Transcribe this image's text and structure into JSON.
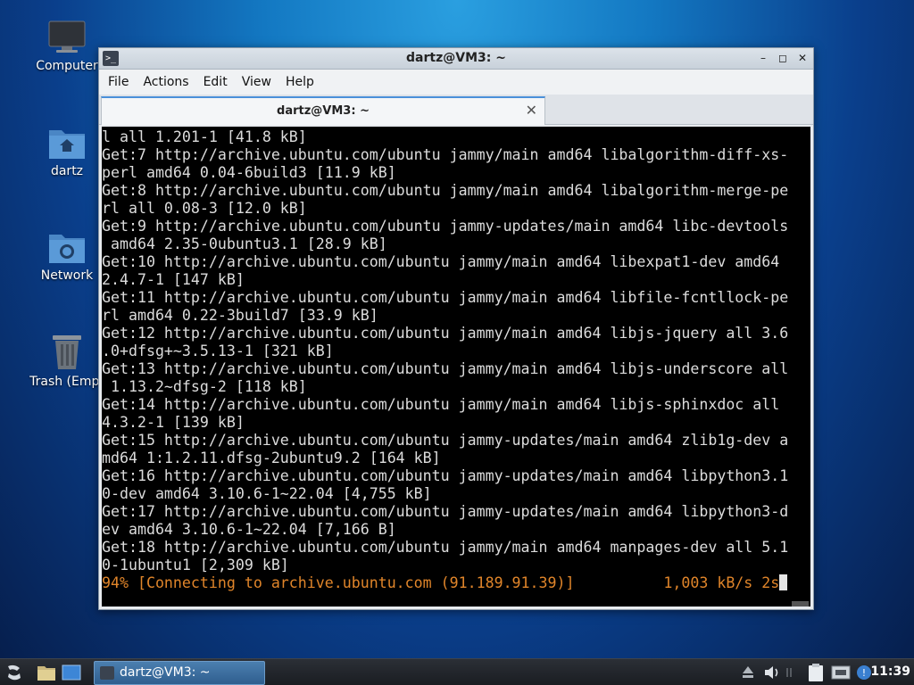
{
  "desktop": {
    "icons": [
      {
        "label": "Computer"
      },
      {
        "label": "dartz"
      },
      {
        "label": "Network"
      },
      {
        "label": "Trash (Empt"
      }
    ]
  },
  "window": {
    "title": "dartz@VM3: ~",
    "menu": [
      "File",
      "Actions",
      "Edit",
      "View",
      "Help"
    ],
    "tab_title": "dartz@VM3: ~"
  },
  "terminal": {
    "lines": [
      "l all 1.201-1 [41.8 kB]",
      "Get:7 http://archive.ubuntu.com/ubuntu jammy/main amd64 libalgorithm-diff-xs-",
      "perl amd64 0.04-6build3 [11.9 kB]",
      "Get:8 http://archive.ubuntu.com/ubuntu jammy/main amd64 libalgorithm-merge-pe",
      "rl all 0.08-3 [12.0 kB]",
      "Get:9 http://archive.ubuntu.com/ubuntu jammy-updates/main amd64 libc-devtools",
      " amd64 2.35-0ubuntu3.1 [28.9 kB]",
      "Get:10 http://archive.ubuntu.com/ubuntu jammy/main amd64 libexpat1-dev amd64",
      "2.4.7-1 [147 kB]",
      "Get:11 http://archive.ubuntu.com/ubuntu jammy/main amd64 libfile-fcntllock-pe",
      "rl amd64 0.22-3build7 [33.9 kB]",
      "Get:12 http://archive.ubuntu.com/ubuntu jammy/main amd64 libjs-jquery all 3.6",
      ".0+dfsg+~3.5.13-1 [321 kB]",
      "Get:13 http://archive.ubuntu.com/ubuntu jammy/main amd64 libjs-underscore all",
      " 1.13.2~dfsg-2 [118 kB]",
      "Get:14 http://archive.ubuntu.com/ubuntu jammy/main amd64 libjs-sphinxdoc all",
      "4.3.2-1 [139 kB]",
      "Get:15 http://archive.ubuntu.com/ubuntu jammy-updates/main amd64 zlib1g-dev a",
      "md64 1:1.2.11.dfsg-2ubuntu9.2 [164 kB]",
      "Get:16 http://archive.ubuntu.com/ubuntu jammy-updates/main amd64 libpython3.1",
      "0-dev amd64 3.10.6-1~22.04 [4,755 kB]",
      "Get:17 http://archive.ubuntu.com/ubuntu jammy-updates/main amd64 libpython3-d",
      "ev amd64 3.10.6-1~22.04 [7,166 B]",
      "Get:18 http://archive.ubuntu.com/ubuntu jammy/main amd64 manpages-dev all 5.1",
      "0-1ubuntu1 [2,309 kB]"
    ],
    "progress_line": "94% [Connecting to archive.ubuntu.com (91.189.91.39)]          1,003 kB/s 2s"
  },
  "taskbar": {
    "task_label": "dartz@VM3: ~",
    "clock": "11:39"
  },
  "colors": {
    "terminal_bg": "#000000",
    "terminal_fg": "#dcdcdc",
    "progress_fg": "#e0852a",
    "accent": "#4a90d9"
  }
}
